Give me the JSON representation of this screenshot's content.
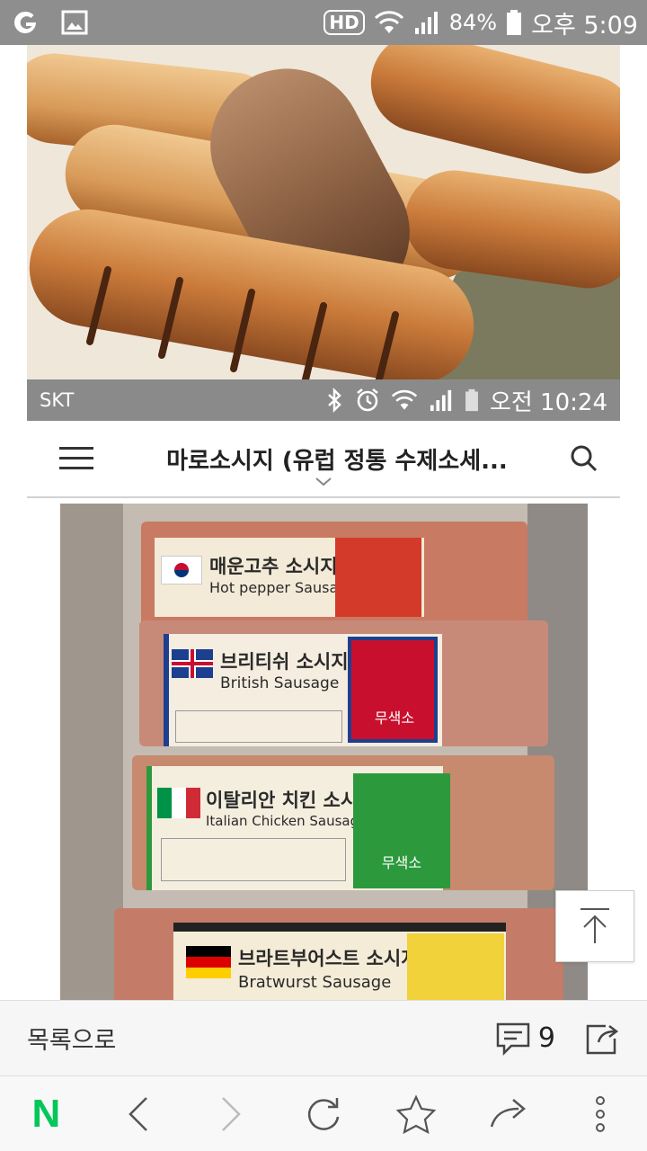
{
  "status_bar": {
    "hd": "HD",
    "battery": "84%",
    "time": "오후 5:09"
  },
  "embedded_screenshot": {
    "carrier": "SKT",
    "time": "오전 10:24",
    "header": {
      "title": "마로소시지 (유럽 정통 수제소세..."
    },
    "packages": [
      {
        "name_ko": "매운고추 소시지",
        "name_en": "Hot pepper Sausage",
        "flag": "KR"
      },
      {
        "name_ko": "브리티쉬 소시지",
        "name_en": "British Sausage",
        "flag": "GB",
        "badge": "무색소"
      },
      {
        "name_ko": "이탈리안 치킨 소시지",
        "name_en": "Italian Chicken Sausage",
        "flag": "IT",
        "badge": "무색소"
      },
      {
        "name_ko": "브라트부어스트 소시지",
        "name_en": "Bratwurst Sausage",
        "flag": "DE"
      }
    ]
  },
  "article_bar": {
    "back_to_list": "목록으로",
    "comment_count": "9"
  },
  "browser_nav": {
    "logo": "N",
    "logo_color": "#03c75a"
  },
  "colors": {
    "status_bar": "#8e8e8e",
    "inner_status_bar": "#8a8a8a"
  }
}
